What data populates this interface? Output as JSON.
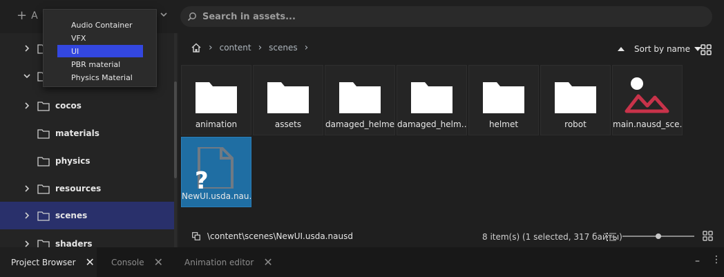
{
  "toolbar": {
    "add_label": "A",
    "search_placeholder": "Search in assets..."
  },
  "dropdown": {
    "items": [
      "Audio Container",
      "VFX",
      "UI",
      "PBR material",
      "Physics Material"
    ],
    "selected": "UI"
  },
  "tree": {
    "items": [
      {
        "label": "",
        "expanded": false
      },
      {
        "label": "",
        "expanded": true
      },
      {
        "label": "cocos",
        "expanded": false
      },
      {
        "label": "materials"
      },
      {
        "label": "physics"
      },
      {
        "label": "resources",
        "expanded": false
      },
      {
        "label": "scenes",
        "expanded": false,
        "selected": true
      },
      {
        "label": "shaders",
        "expanded": false
      }
    ]
  },
  "breadcrumb": {
    "items": [
      "content",
      "scenes"
    ]
  },
  "sort": {
    "label": "Sort by name"
  },
  "assets": [
    {
      "name": "animation",
      "type": "folder"
    },
    {
      "name": "assets",
      "type": "folder"
    },
    {
      "name": "damaged_helmet",
      "type": "folder"
    },
    {
      "name": "damaged_helm…",
      "type": "folder"
    },
    {
      "name": "helmet",
      "type": "folder"
    },
    {
      "name": "robot",
      "type": "folder"
    },
    {
      "name": "main.nausd_sce…",
      "type": "scene"
    },
    {
      "name": "NewUI.usda.nau…",
      "type": "unknown",
      "selected": true
    }
  ],
  "status": {
    "path": "\\content\\scenes\\NewUI.usda.nausd",
    "count": "8 item(s) (1 selected, 317 байты)",
    "zoom_fraction": 0.5
  },
  "tabs": [
    {
      "label": "Project Browser",
      "active": true
    },
    {
      "label": "Console",
      "active": false
    },
    {
      "label": "Animation editor",
      "active": false
    }
  ],
  "colors": {
    "accent": "#3347e0",
    "selection": "#1f6ea3",
    "tree_selection": "#29306b",
    "scene_icon": "#c8334a"
  }
}
